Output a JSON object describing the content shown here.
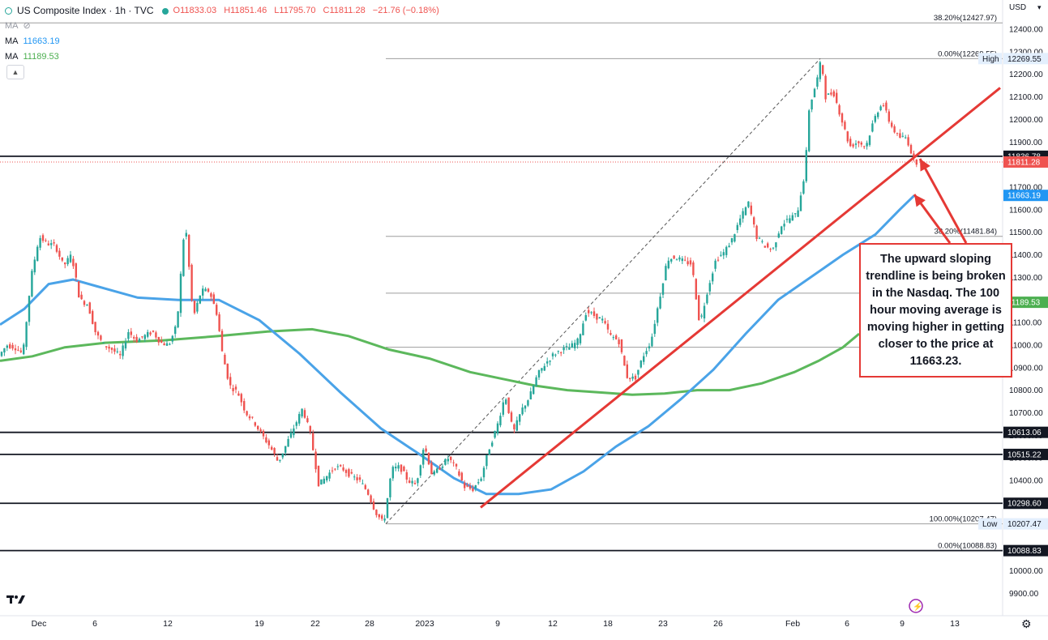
{
  "legend": {
    "title": "US Composite Index · 1h · TVC",
    "open": "O11833.03",
    "high": "H11851.46",
    "low": "L11795.70",
    "close": "C11811.28",
    "change": "−21.76 (−0.18%)",
    "ma_hidden_label": "MA",
    "ma1_label": "MA",
    "ma1_value": "11663.19",
    "ma2_label": "MA",
    "ma2_value": "11189.53"
  },
  "currency": "USD",
  "annotation": "The upward sloping trendline is being broken in the Nasdaq. The 100 hour moving average is moving higher in getting closer to the price at 11663.23.",
  "colors": {
    "up": "#26a69a",
    "down": "#ef5350",
    "ma100": "#4aa3e8",
    "ma200": "#5cb85c",
    "trend": "#e53935",
    "fib": "#9e9e9e",
    "hline": "#131722"
  },
  "icons": [
    "tradingview-logo-icon",
    "settings-gear-icon",
    "eye-off-icon",
    "chevron-up-icon",
    "lightning-icon",
    "chevron-down-icon"
  ],
  "chart_data": {
    "type": "candlestick",
    "title": "US Composite Index · 1h · TVC",
    "ylim": [
      9850,
      12470
    ],
    "y_ticks": [
      9900,
      10000,
      10100,
      10200,
      10300,
      10400,
      10500,
      10600,
      10700,
      10800,
      10900,
      11000,
      11100,
      11200,
      11300,
      11400,
      11500,
      11600,
      11700,
      11800,
      11900,
      12000,
      12100,
      12200,
      12300,
      12400
    ],
    "y_tick_labels": [
      "9900.00",
      "10000.00",
      "10100.00",
      "10200.00",
      "10300.00",
      "10400.00",
      "10500.00",
      "10600.00",
      "10700.00",
      "10800.00",
      "10900.00",
      "11000.00",
      "11100.00",
      "11200.00",
      "11300.00",
      "11400.00",
      "11500.00",
      "11600.00",
      "11700.00",
      "11800.00",
      "11900.00",
      "12000.00",
      "12100.00",
      "12200.00",
      "12300.00",
      "12400.00"
    ],
    "x_labels": [
      "Dec",
      "6",
      "12",
      "19",
      "22",
      "28",
      "2023",
      "9",
      "12",
      "18",
      "23",
      "26",
      "Feb",
      "6",
      "9",
      "13"
    ],
    "price_path": [
      [
        0,
        10950
      ],
      [
        10,
        11000
      ],
      [
        20,
        10990
      ],
      [
        30,
        10960
      ],
      [
        40,
        11300
      ],
      [
        50,
        11480
      ],
      [
        60,
        11450
      ],
      [
        70,
        11440
      ],
      [
        80,
        11350
      ],
      [
        90,
        11400
      ],
      [
        100,
        11200
      ],
      [
        110,
        11180
      ],
      [
        120,
        11050
      ],
      [
        130,
        11000
      ],
      [
        140,
        10980
      ],
      [
        150,
        10950
      ],
      [
        160,
        11060
      ],
      [
        170,
        11020
      ],
      [
        180,
        11040
      ],
      [
        190,
        11060
      ],
      [
        200,
        11010
      ],
      [
        210,
        11000
      ],
      [
        220,
        11090
      ],
      [
        230,
        11560
      ],
      [
        240,
        11120
      ],
      [
        250,
        11240
      ],
      [
        260,
        11240
      ],
      [
        270,
        11130
      ],
      [
        275,
        10980
      ],
      [
        285,
        10820
      ],
      [
        295,
        10790
      ],
      [
        305,
        10700
      ],
      [
        315,
        10660
      ],
      [
        325,
        10600
      ],
      [
        335,
        10550
      ],
      [
        345,
        10480
      ],
      [
        355,
        10560
      ],
      [
        365,
        10640
      ],
      [
        375,
        10720
      ],
      [
        385,
        10600
      ],
      [
        395,
        10380
      ],
      [
        405,
        10420
      ],
      [
        415,
        10460
      ],
      [
        425,
        10450
      ],
      [
        435,
        10420
      ],
      [
        445,
        10400
      ],
      [
        455,
        10350
      ],
      [
        465,
        10260
      ],
      [
        475,
        10208
      ],
      [
        485,
        10450
      ],
      [
        495,
        10460
      ],
      [
        505,
        10400
      ],
      [
        515,
        10380
      ],
      [
        525,
        10560
      ],
      [
        535,
        10420
      ],
      [
        545,
        10460
      ],
      [
        555,
        10500
      ],
      [
        565,
        10450
      ],
      [
        575,
        10370
      ],
      [
        585,
        10360
      ],
      [
        595,
        10410
      ],
      [
        605,
        10540
      ],
      [
        615,
        10640
      ],
      [
        625,
        10780
      ],
      [
        635,
        10610
      ],
      [
        645,
        10710
      ],
      [
        655,
        10770
      ],
      [
        665,
        10870
      ],
      [
        675,
        10920
      ],
      [
        685,
        10960
      ],
      [
        695,
        10980
      ],
      [
        705,
        10990
      ],
      [
        715,
        11020
      ],
      [
        725,
        11150
      ],
      [
        735,
        11130
      ],
      [
        745,
        11110
      ],
      [
        755,
        11040
      ],
      [
        765,
        11020
      ],
      [
        775,
        10860
      ],
      [
        785,
        10850
      ],
      [
        795,
        10950
      ],
      [
        805,
        11020
      ],
      [
        815,
        11200
      ],
      [
        825,
        11380
      ],
      [
        835,
        11390
      ],
      [
        845,
        11370
      ],
      [
        855,
        11360
      ],
      [
        865,
        11090
      ],
      [
        875,
        11250
      ],
      [
        885,
        11380
      ],
      [
        895,
        11410
      ],
      [
        905,
        11470
      ],
      [
        915,
        11560
      ],
      [
        925,
        11630
      ],
      [
        935,
        11480
      ],
      [
        945,
        11440
      ],
      [
        955,
        11420
      ],
      [
        965,
        11530
      ],
      [
        975,
        11560
      ],
      [
        985,
        11580
      ],
      [
        995,
        11770
      ],
      [
        1000,
        12050
      ],
      [
        1010,
        12180
      ],
      [
        1015,
        12269
      ],
      [
        1020,
        12100
      ],
      [
        1030,
        12120
      ],
      [
        1040,
        12000
      ],
      [
        1050,
        11880
      ],
      [
        1060,
        11900
      ],
      [
        1070,
        11880
      ],
      [
        1080,
        12000
      ],
      [
        1090,
        12080
      ],
      [
        1100,
        11980
      ],
      [
        1110,
        11920
      ],
      [
        1120,
        11920
      ],
      [
        1130,
        11811
      ]
    ],
    "ma100_path": [
      [
        0,
        11090
      ],
      [
        30,
        11160
      ],
      [
        60,
        11270
      ],
      [
        90,
        11290
      ],
      [
        120,
        11260
      ],
      [
        170,
        11210
      ],
      [
        220,
        11200
      ],
      [
        270,
        11200
      ],
      [
        320,
        11110
      ],
      [
        370,
        10960
      ],
      [
        420,
        10790
      ],
      [
        470,
        10630
      ],
      [
        520,
        10510
      ],
      [
        560,
        10410
      ],
      [
        600,
        10340
      ],
      [
        640,
        10340
      ],
      [
        680,
        10360
      ],
      [
        720,
        10440
      ],
      [
        760,
        10550
      ],
      [
        800,
        10640
      ],
      [
        840,
        10760
      ],
      [
        880,
        10890
      ],
      [
        920,
        11050
      ],
      [
        960,
        11200
      ],
      [
        1000,
        11300
      ],
      [
        1040,
        11400
      ],
      [
        1080,
        11490
      ],
      [
        1110,
        11600
      ],
      [
        1128,
        11663
      ]
    ],
    "ma200_path": [
      [
        0,
        10930
      ],
      [
        40,
        10950
      ],
      [
        80,
        10990
      ],
      [
        130,
        11010
      ],
      [
        200,
        11020
      ],
      [
        270,
        11040
      ],
      [
        330,
        11060
      ],
      [
        385,
        11070
      ],
      [
        430,
        11040
      ],
      [
        480,
        10980
      ],
      [
        530,
        10940
      ],
      [
        580,
        10880
      ],
      [
        620,
        10850
      ],
      [
        660,
        10820
      ],
      [
        700,
        10800
      ],
      [
        740,
        10790
      ],
      [
        780,
        10780
      ],
      [
        820,
        10785
      ],
      [
        860,
        10800
      ],
      [
        900,
        10800
      ],
      [
        940,
        10830
      ],
      [
        980,
        10880
      ],
      [
        1010,
        10930
      ],
      [
        1040,
        10990
      ],
      [
        1060,
        11050
      ]
    ],
    "series": [
      {
        "name": "MA",
        "last": 11663.19
      },
      {
        "name": "MA",
        "last": 11189.53
      }
    ],
    "horizontal_lines": [
      11836.78,
      10613.06,
      10515.22,
      10298.6,
      10088.83
    ],
    "fib_levels": [
      {
        "label": "38.20%(12427.97)",
        "value": 12427.97
      },
      {
        "label": "0.00%(12269.55)",
        "value": 12269.55
      },
      {
        "label": "38.20%(11481.84)",
        "value": 11481.84
      },
      {
        "label": "",
        "value": 11230
      },
      {
        "label": "",
        "value": 10990
      },
      {
        "label": "100.00%(10207.47)",
        "value": 10207.47
      },
      {
        "label": "0.00%(10088.83)",
        "value": 10088.83
      }
    ],
    "price_labels": [
      {
        "text": "High",
        "value": "12269.55",
        "y": 12269.55,
        "kind": "high"
      },
      {
        "text": "",
        "value": "11836.78",
        "y": 11836.78,
        "kind": "line"
      },
      {
        "text": "",
        "value": "11811.28",
        "y": 11811.28,
        "kind": "last"
      },
      {
        "text": "",
        "value": "11663.19",
        "y": 11663.19,
        "kind": "ma1"
      },
      {
        "text": "",
        "value": "11189.53",
        "y": 11189.53,
        "kind": "ma2"
      },
      {
        "text": "",
        "value": "10613.06",
        "y": 10613.06,
        "kind": "line"
      },
      {
        "text": "",
        "value": "10515.22",
        "y": 10515.22,
        "kind": "line"
      },
      {
        "text": "",
        "value": "10298.60",
        "y": 10298.6,
        "kind": "line"
      },
      {
        "text": "Low",
        "value": "10207.47",
        "y": 10207.47,
        "kind": "low"
      },
      {
        "text": "",
        "value": "10088.83",
        "y": 10088.83,
        "kind": "line"
      }
    ]
  }
}
